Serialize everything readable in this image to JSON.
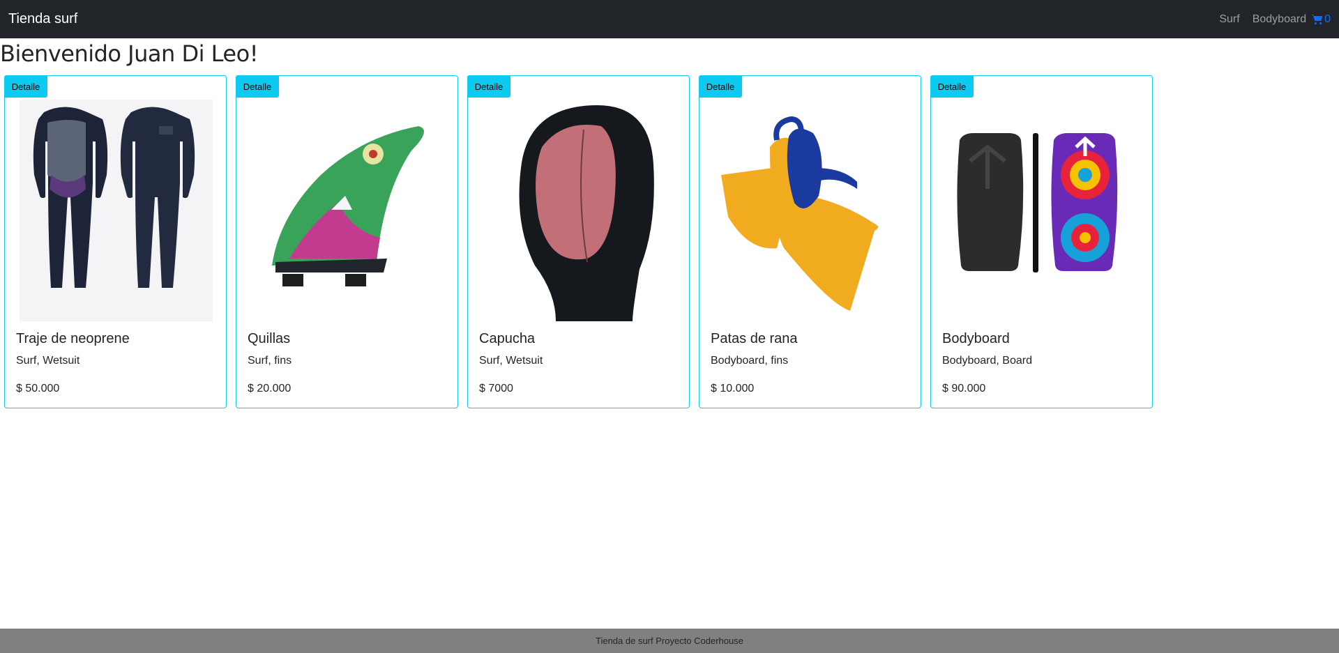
{
  "navbar": {
    "brand": "Tienda surf",
    "links": [
      "Surf",
      "Bodyboard"
    ],
    "cart_count": "0",
    "cart_icon": "cart-icon"
  },
  "welcome": "Bienvenido Juan Di Leo!",
  "products": [
    {
      "badge": "Detalle",
      "title": "Traje de neoprene",
      "tags": "Surf, Wetsuit",
      "price": "$ 50.000",
      "image": "wetsuit-image"
    },
    {
      "badge": "Detalle",
      "title": "Quillas",
      "tags": "Surf, fins",
      "price": "$ 20.000",
      "image": "fin-image"
    },
    {
      "badge": "Detalle",
      "title": "Capucha",
      "tags": "Surf, Wetsuit",
      "price": "$ 7000",
      "image": "hood-image"
    },
    {
      "badge": "Detalle",
      "title": "Patas de rana",
      "tags": "Bodyboard, fins",
      "price": "$ 10.000",
      "image": "swim-fins-image"
    },
    {
      "badge": "Detalle",
      "title": "Bodyboard",
      "tags": "Bodyboard, Board",
      "price": "$ 90.000",
      "image": "bodyboard-image"
    }
  ],
  "footer": "Tienda de surf Proyecto Coderhouse",
  "colors": {
    "navbar": "#212529",
    "accent": "#0dcaf0",
    "cart": "#0d6efd",
    "footer": "#808080"
  }
}
